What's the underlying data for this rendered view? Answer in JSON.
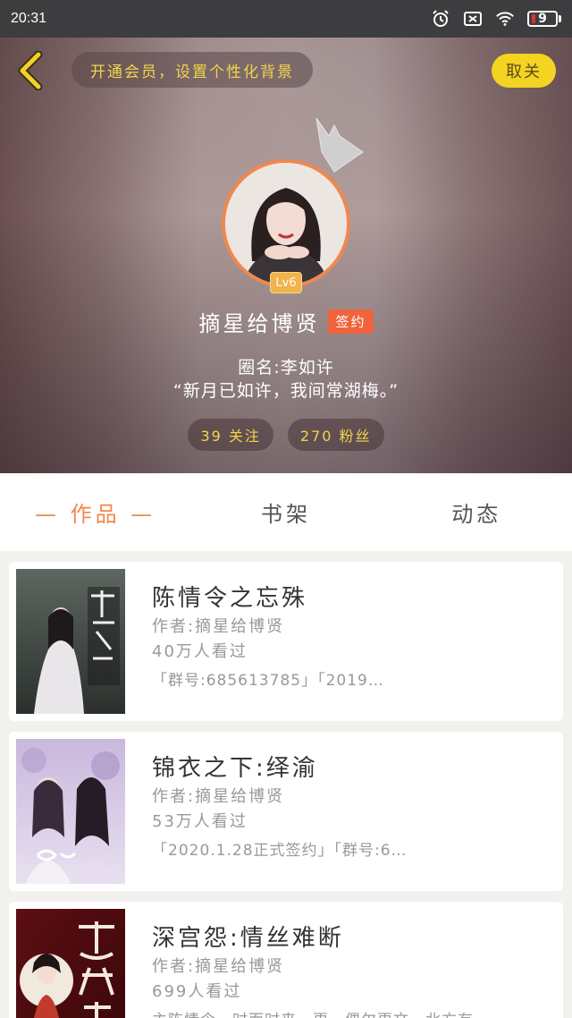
{
  "status_bar": {
    "time": "20:31",
    "battery_level": "9",
    "icons": [
      "alarm-icon",
      "sim-off-icon",
      "wifi-icon",
      "battery-icon"
    ]
  },
  "header": {
    "vip_banner": "开通会员，设置个性化背景",
    "unfollow_label": "取关",
    "accent_color": "#f4d321"
  },
  "profile": {
    "level": "Lv6",
    "name": "摘星给博贤",
    "signed_badge": "签约",
    "circle_name": "圈名:李如许",
    "bio": "“新月已如许，我间常湖梅。”",
    "following": "39 关注",
    "followers": "270 粉丝"
  },
  "tabs": {
    "works": "— 作品 —",
    "bookshelf": "书架",
    "activity": "动态",
    "active_color": "#f0884c"
  },
  "books": [
    {
      "title": "陈情令之忘殊",
      "author": "作者:摘星给博贤",
      "views": "40万人看过",
      "tags": "「群号:685613785」「2019…"
    },
    {
      "title": "锦衣之下:绎渝",
      "author": "作者:摘星给博贤",
      "views": "53万人看过",
      "tags": "「2020.1.28正式签约」「群号:6…"
    },
    {
      "title": "深宫怨:情丝难断",
      "author": "作者:摘星给博贤",
      "views": "699人看过",
      "tags": "主陈情令，时而时来一更，偶尔更文，北方有…"
    }
  ]
}
